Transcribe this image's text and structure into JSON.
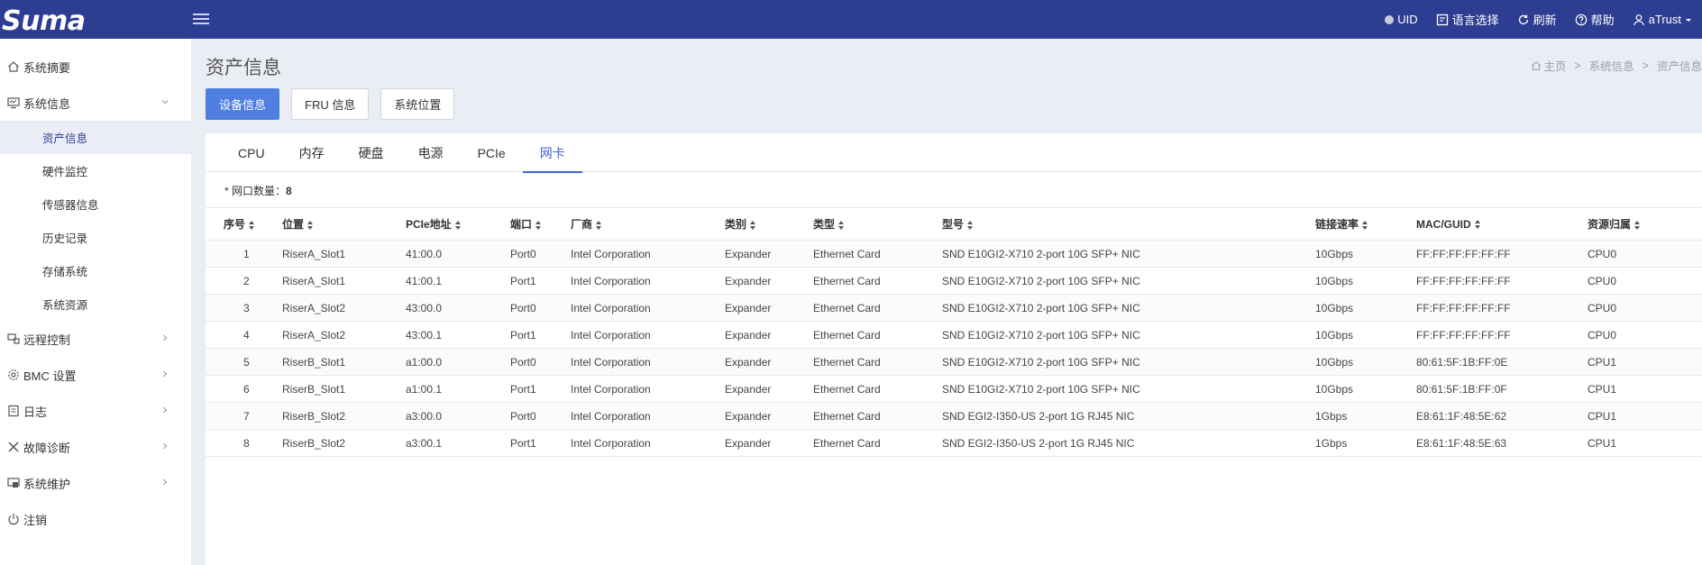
{
  "topbar": {
    "logo": "Suma",
    "nav": [
      {
        "icon": "uid-dot-icon",
        "label": "UID"
      },
      {
        "icon": "language-icon",
        "label": "语言选择"
      },
      {
        "icon": "refresh-icon",
        "label": "刷新"
      },
      {
        "icon": "help-icon",
        "label": "帮助"
      },
      {
        "icon": "user-icon",
        "label": "aTrust"
      }
    ]
  },
  "sidebar": {
    "items": [
      {
        "icon": "home-icon",
        "label": "系统摘要"
      },
      {
        "icon": "monitor-icon",
        "label": "系统信息"
      },
      {
        "icon": "remote-icon",
        "label": "远程控制"
      },
      {
        "icon": "gear-icon",
        "label": "BMC 设置"
      },
      {
        "icon": "log-icon",
        "label": "日志"
      },
      {
        "icon": "tools-icon",
        "label": "故障诊断"
      },
      {
        "icon": "maintenance-icon",
        "label": "系统维护"
      },
      {
        "icon": "power-icon",
        "label": "注销"
      }
    ],
    "sub_items": [
      "资产信息",
      "硬件监控",
      "传感器信息",
      "历史记录",
      "存储系统",
      "系统资源"
    ]
  },
  "page": {
    "title": "资产信息",
    "breadcrumb": [
      "主页",
      "系统信息",
      "资产信息"
    ],
    "buttons": [
      "设备信息",
      "FRU 信息",
      "系统位置"
    ],
    "tabs": [
      "CPU",
      "内存",
      "硬盘",
      "电源",
      "PCIe",
      "网卡"
    ],
    "count_label": "* 网口数量：",
    "count_value": "8"
  },
  "table": {
    "headers": [
      "序号",
      "位置",
      "PCIe地址",
      "端口",
      "厂商",
      "类别",
      "类型",
      "型号",
      "链接速率",
      "MAC/GUID",
      "资源归属"
    ],
    "rows": [
      [
        "1",
        "RiserA_Slot1",
        "41:00.0",
        "Port0",
        "Intel Corporation",
        "Expander",
        "Ethernet Card",
        "SND E10GI2-X710 2-port 10G SFP+ NIC",
        "10Gbps",
        "FF:FF:FF:FF:FF:FF",
        "CPU0"
      ],
      [
        "2",
        "RiserA_Slot1",
        "41:00.1",
        "Port1",
        "Intel Corporation",
        "Expander",
        "Ethernet Card",
        "SND E10GI2-X710 2-port 10G SFP+ NIC",
        "10Gbps",
        "FF:FF:FF:FF:FF:FF",
        "CPU0"
      ],
      [
        "3",
        "RiserA_Slot2",
        "43:00.0",
        "Port0",
        "Intel Corporation",
        "Expander",
        "Ethernet Card",
        "SND E10GI2-X710 2-port 10G SFP+ NIC",
        "10Gbps",
        "FF:FF:FF:FF:FF:FF",
        "CPU0"
      ],
      [
        "4",
        "RiserA_Slot2",
        "43:00.1",
        "Port1",
        "Intel Corporation",
        "Expander",
        "Ethernet Card",
        "SND E10GI2-X710 2-port 10G SFP+ NIC",
        "10Gbps",
        "FF:FF:FF:FF:FF:FF",
        "CPU0"
      ],
      [
        "5",
        "RiserB_Slot1",
        "a1:00.0",
        "Port0",
        "Intel Corporation",
        "Expander",
        "Ethernet Card",
        "SND E10GI2-X710 2-port 10G SFP+ NIC",
        "10Gbps",
        "80:61:5F:1B:FF:0E",
        "CPU1"
      ],
      [
        "6",
        "RiserB_Slot1",
        "a1:00.1",
        "Port1",
        "Intel Corporation",
        "Expander",
        "Ethernet Card",
        "SND E10GI2-X710 2-port 10G SFP+ NIC",
        "10Gbps",
        "80:61:5F:1B:FF:0F",
        "CPU1"
      ],
      [
        "7",
        "RiserB_Slot2",
        "a3:00.0",
        "Port0",
        "Intel Corporation",
        "Expander",
        "Ethernet Card",
        "SND EGI2-I350-US 2-port 1G RJ45 NIC",
        "1Gbps",
        "E8:61:1F:48:5E:62",
        "CPU1"
      ],
      [
        "8",
        "RiserB_Slot2",
        "a3:00.1",
        "Port1",
        "Intel Corporation",
        "Expander",
        "Ethernet Card",
        "SND EGI2-I350-US 2-port 1G RJ45 NIC",
        "1Gbps",
        "E8:61:1F:48:5E:63",
        "CPU1"
      ]
    ]
  },
  "colors": {
    "topbar": "#2d3d91",
    "primary_button": "#4f7fe0",
    "active_tab": "#3b63d6"
  }
}
